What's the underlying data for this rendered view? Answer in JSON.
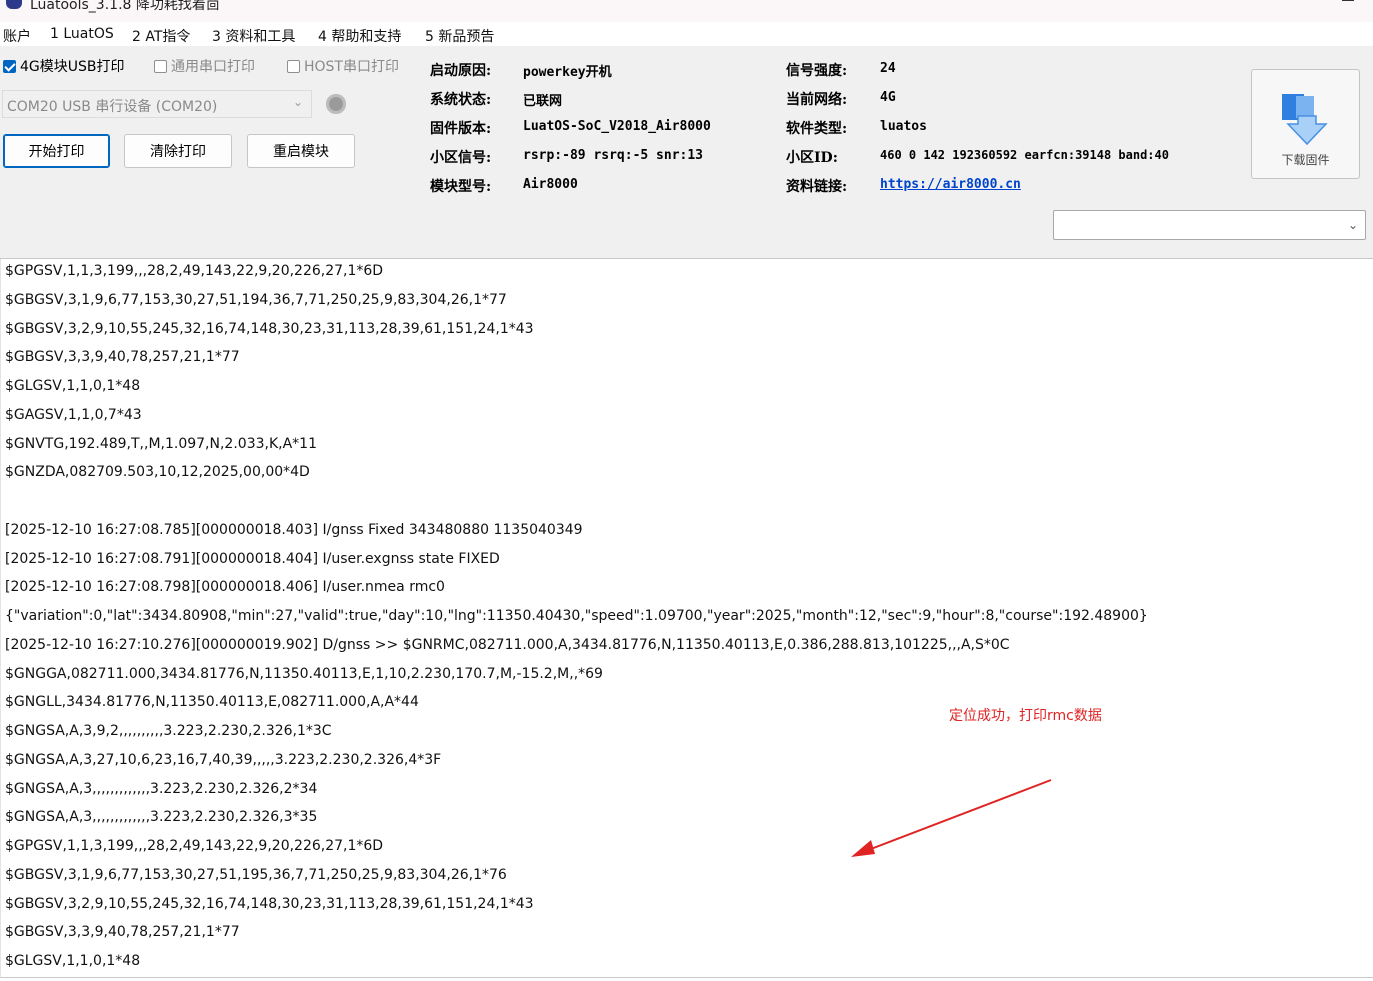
{
  "window": {
    "title": "Luatools_3.1.8 降功耗找着茴"
  },
  "menu": [
    "账户",
    "1 LuatOS",
    "2 AT指令",
    "3 资料和工具",
    "4 帮助和支持",
    "5 新品预告"
  ],
  "options": {
    "usb_print": {
      "label": "4G模块USB打印",
      "checked": true
    },
    "uart_print": {
      "label": "通用串口打印",
      "checked": false
    },
    "host_print": {
      "label": "HOST串口打印",
      "checked": false
    }
  },
  "port": {
    "selected": "COM20 USB 串行设备 (COM20)"
  },
  "buttons": {
    "start": "开始打印",
    "clear": "清除打印",
    "restart": "重启模块",
    "download": "下载固件"
  },
  "info": {
    "boot_reason_label": "启动原因:",
    "boot_reason": "powerkey开机",
    "system_status_label": "系统状态:",
    "system_status": "已联网",
    "firmware_label": "固件版本:",
    "firmware": "LuatOS-SoC_V2018_Air8000",
    "cell_signal_label": "小区信号:",
    "cell_signal": "rsrp:-89 rsrq:-5 snr:13",
    "model_label": "模块型号:",
    "model": "Air8000",
    "signal_strength_label": "信号强度:",
    "signal_strength": "24",
    "network_label": "当前网络:",
    "network": "4G",
    "software_label": "软件类型:",
    "software": "luatos",
    "cell_id_label": "小区ID:",
    "cell_id": "460 0 142 192360592 earfcn:39148 band:40",
    "link_label": "资料链接:",
    "link": "https://air8000.cn"
  },
  "log": [
    "$GPGSV,1,1,3,199,,,28,2,49,143,22,9,20,226,27,1*6D",
    "$GBGSV,3,1,9,6,77,153,30,27,51,194,36,7,71,250,25,9,83,304,26,1*77",
    "$GBGSV,3,2,9,10,55,245,32,16,74,148,30,23,31,113,28,39,61,151,24,1*43",
    "$GBGSV,3,3,9,40,78,257,21,1*77",
    "$GLGSV,1,1,0,1*48",
    "$GAGSV,1,1,0,7*43",
    "$GNVTG,192.489,T,,M,1.097,N,2.033,K,A*11",
    "$GNZDA,082709.503,10,12,2025,00,00*4D",
    "",
    "[2025-12-10 16:27:08.785][000000018.403] I/gnss Fixed 343480880 1135040349",
    "[2025-12-10 16:27:08.791][000000018.404] I/user.exgnss state FIXED",
    "[2025-12-10 16:27:08.798][000000018.406] I/user.nmea rmc0",
    "{\"variation\":0,\"lat\":3434.80908,\"min\":27,\"valid\":true,\"day\":10,\"lng\":11350.40430,\"speed\":1.09700,\"year\":2025,\"month\":12,\"sec\":9,\"hour\":8,\"course\":192.48900}",
    "[2025-12-10 16:27:10.276][000000019.902] D/gnss >> $GNRMC,082711.000,A,3434.81776,N,11350.40113,E,0.386,288.813,101225,,,A,S*0C",
    "$GNGGA,082711.000,3434.81776,N,11350.40113,E,1,10,2.230,170.7,M,-15.2,M,,*69",
    "$GNGLL,3434.81776,N,11350.40113,E,082711.000,A,A*44",
    "$GNGSA,A,3,9,2,,,,,,,,,,3.223,2.230,2.326,1*3C",
    "$GNGSA,A,3,27,10,6,23,16,7,40,39,,,,,3.223,2.230,2.326,4*3F",
    "$GNGSA,A,3,,,,,,,,,,,,,3.223,2.230,2.326,2*34",
    "$GNGSA,A,3,,,,,,,,,,,,,3.223,2.230,2.326,3*35",
    "$GPGSV,1,1,3,199,,,28,2,49,143,22,9,20,226,27,1*6D",
    "$GBGSV,3,1,9,6,77,153,30,27,51,195,36,7,71,250,25,9,83,304,26,1*76",
    "$GBGSV,3,2,9,10,55,245,32,16,74,148,30,23,31,113,28,39,61,151,24,1*43",
    "$GBGSV,3,3,9,40,78,257,21,1*77",
    "$GLGSV,1,1,0,1*48"
  ],
  "annotation": "定位成功，打印rmc数据",
  "colors": {
    "accent": "#0067c0",
    "annotation": "#e02424",
    "link": "#0044cc"
  }
}
